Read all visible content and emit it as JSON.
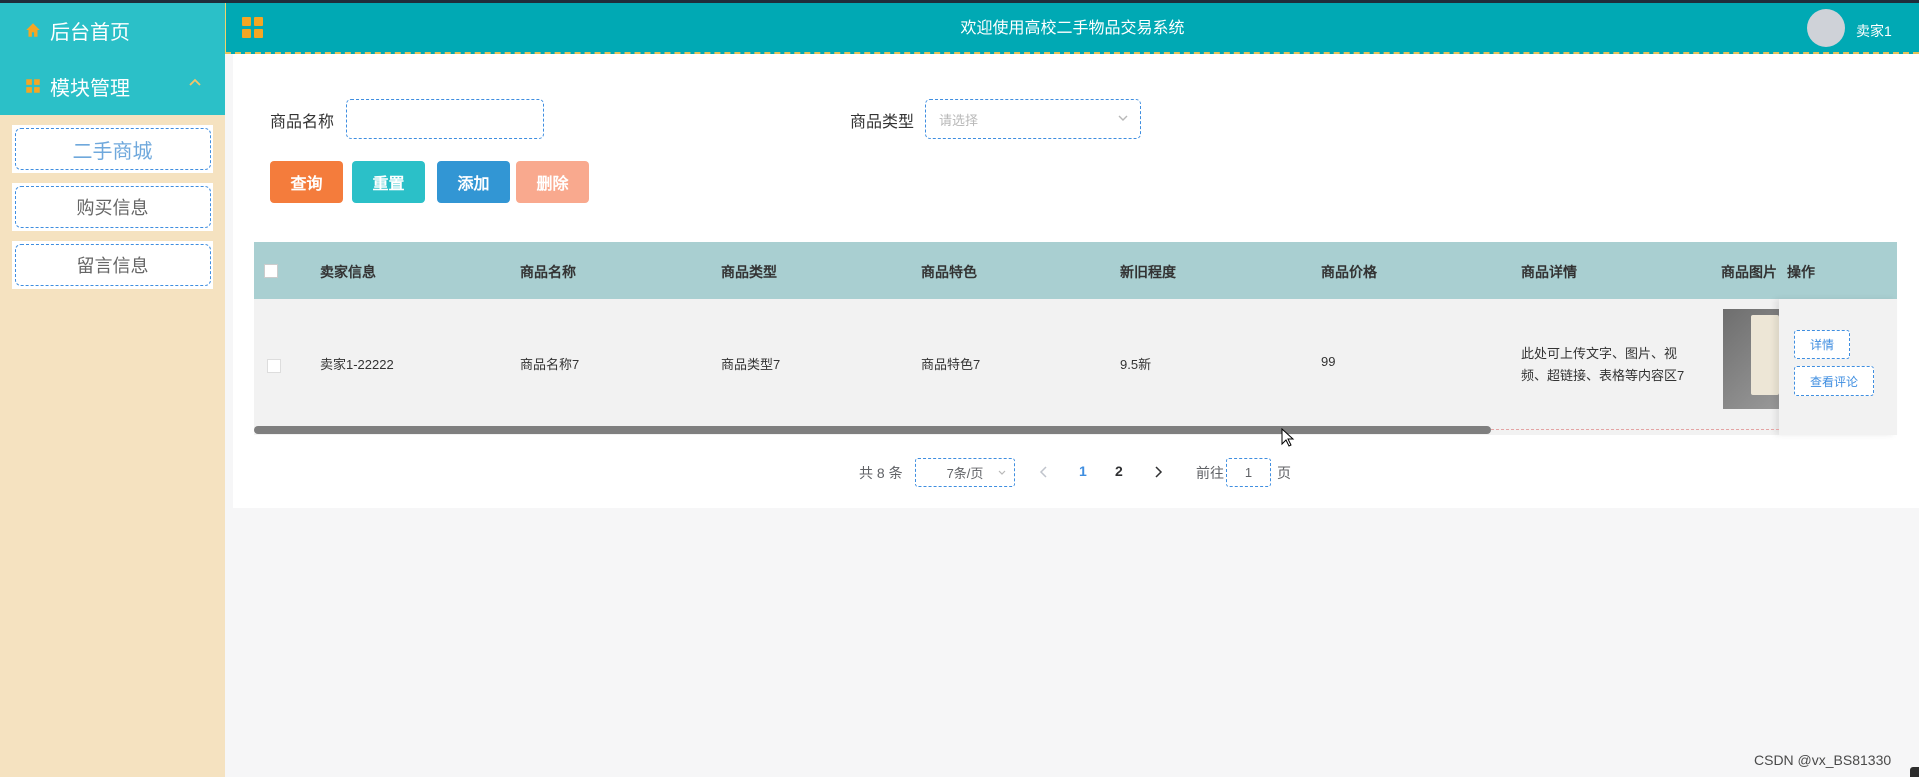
{
  "header": {
    "title": "欢迎使用高校二手物品交易系统",
    "username": "卖家1"
  },
  "sidebar": {
    "home_label": "后台首页",
    "module_label": "模块管理",
    "items": [
      {
        "label": "二手商城"
      },
      {
        "label": "购买信息"
      },
      {
        "label": "留言信息"
      }
    ]
  },
  "search": {
    "name_label": "商品名称",
    "name_value": "",
    "type_label": "商品类型",
    "type_placeholder": "请选择"
  },
  "buttons": {
    "query": "查询",
    "reset": "重置",
    "add": "添加",
    "delete": "删除"
  },
  "colors": {
    "query": "#f47c3c",
    "reset": "#2bc0c8",
    "add": "#3296d4",
    "delete": "#f9a98e",
    "header": "#00a9b4",
    "sidebar_bg": "#f5e2c0"
  },
  "table": {
    "columns": [
      "卖家信息",
      "商品名称",
      "商品类型",
      "商品特色",
      "新旧程度",
      "商品价格",
      "商品详情",
      "商品图片",
      "操作"
    ],
    "rows": [
      {
        "seller": "卖家1-22222",
        "name": "商品名称7",
        "type": "商品类型7",
        "feature": "商品特色7",
        "condition": "9.5新",
        "price": "99",
        "detail_line1": "此处可上传文字、图片、视",
        "detail_line2": "频、超链接、表格等内容区7",
        "ops": [
          "详情",
          "查看评论"
        ]
      }
    ]
  },
  "pagination": {
    "total": "共 8 条",
    "page_size": "7条/页",
    "pages": [
      "1",
      "2"
    ],
    "current": "1",
    "goto_label": "前往",
    "goto_value": "1",
    "page_suffix": "页"
  },
  "watermark": "CSDN @vx_BS81330"
}
